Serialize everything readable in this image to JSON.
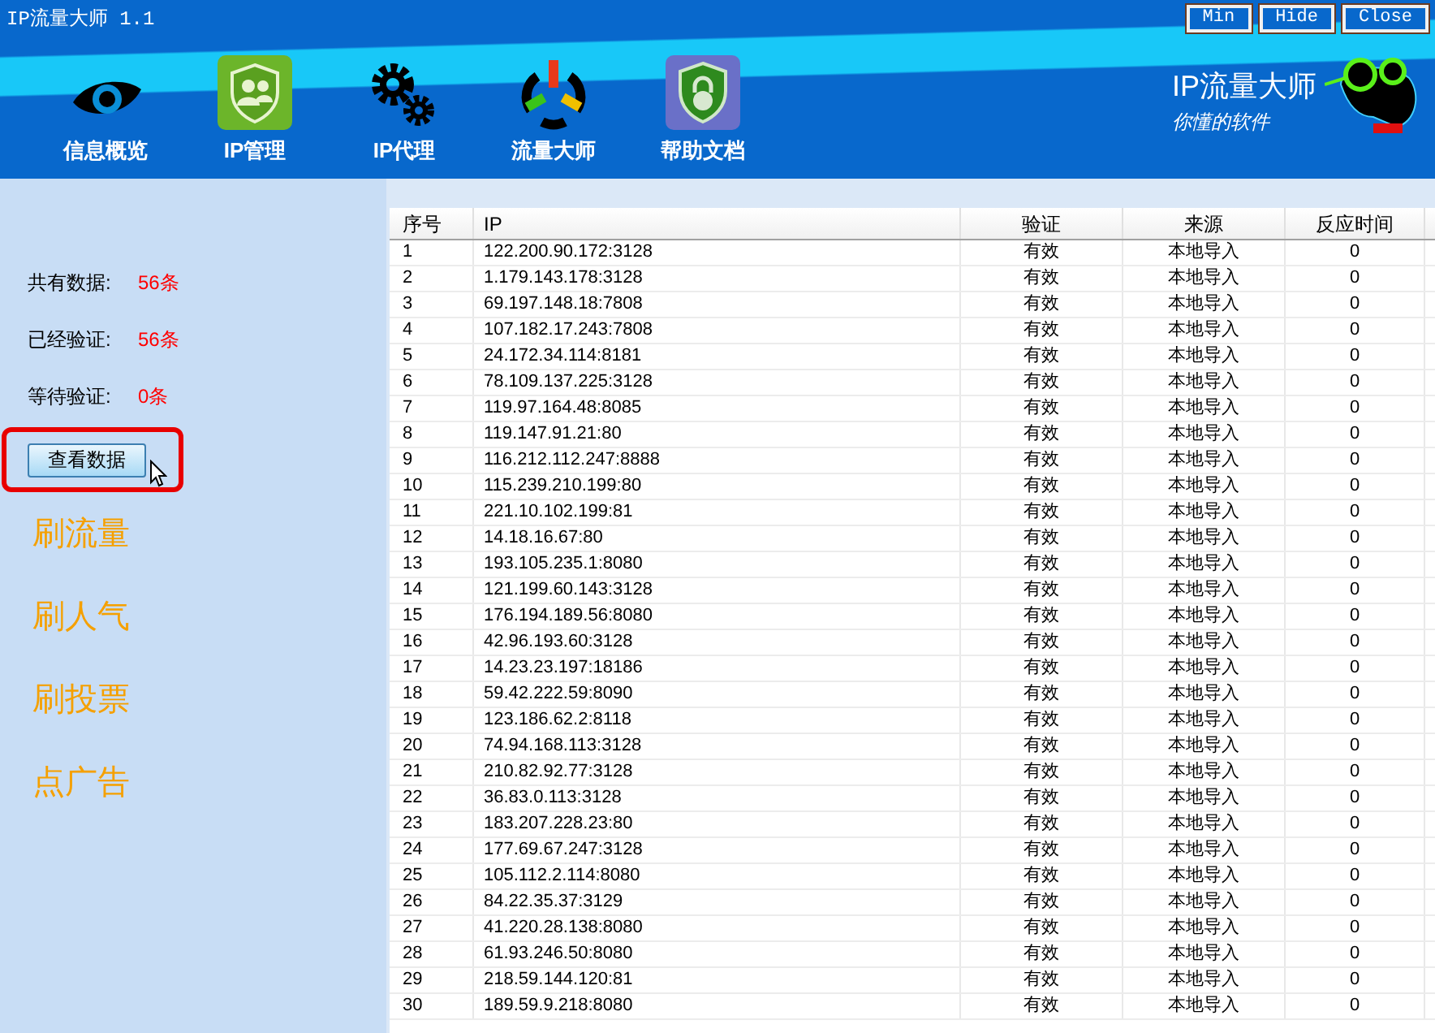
{
  "window": {
    "title": "IP流量大师 1.1",
    "buttons": [
      "Min",
      "Hide",
      "Close"
    ]
  },
  "nav": [
    {
      "label": "信息概览",
      "kind": "eye"
    },
    {
      "label": "IP管理",
      "kind": "users"
    },
    {
      "label": "IP代理",
      "kind": "gears"
    },
    {
      "label": "流量大师",
      "kind": "power"
    },
    {
      "label": "帮助文档",
      "kind": "lock"
    }
  ],
  "brand": {
    "name": "IP流量大师",
    "slogan": "你懂的软件"
  },
  "stats": [
    {
      "label": "共有数据:",
      "value": "56条"
    },
    {
      "label": "已经验证:",
      "value": "56条"
    },
    {
      "label": "等待验证:",
      "value": "0条"
    }
  ],
  "view_button": "查看数据",
  "links": [
    "刷流量",
    "刷人气",
    "刷投票",
    "点广告"
  ],
  "table": {
    "columns": [
      "序号",
      "IP",
      "验证",
      "来源",
      "反应时间"
    ],
    "rows": [
      [
        "1",
        "122.200.90.172:3128",
        "有效",
        "本地导入",
        "0"
      ],
      [
        "2",
        "1.179.143.178:3128",
        "有效",
        "本地导入",
        "0"
      ],
      [
        "3",
        "69.197.148.18:7808",
        "有效",
        "本地导入",
        "0"
      ],
      [
        "4",
        "107.182.17.243:7808",
        "有效",
        "本地导入",
        "0"
      ],
      [
        "5",
        "24.172.34.114:8181",
        "有效",
        "本地导入",
        "0"
      ],
      [
        "6",
        "78.109.137.225:3128",
        "有效",
        "本地导入",
        "0"
      ],
      [
        "7",
        "119.97.164.48:8085",
        "有效",
        "本地导入",
        "0"
      ],
      [
        "8",
        "119.147.91.21:80",
        "有效",
        "本地导入",
        "0"
      ],
      [
        "9",
        "116.212.112.247:8888",
        "有效",
        "本地导入",
        "0"
      ],
      [
        "10",
        "115.239.210.199:80",
        "有效",
        "本地导入",
        "0"
      ],
      [
        "11",
        "221.10.102.199:81",
        "有效",
        "本地导入",
        "0"
      ],
      [
        "12",
        "14.18.16.67:80",
        "有效",
        "本地导入",
        "0"
      ],
      [
        "13",
        "193.105.235.1:8080",
        "有效",
        "本地导入",
        "0"
      ],
      [
        "14",
        "121.199.60.143:3128",
        "有效",
        "本地导入",
        "0"
      ],
      [
        "15",
        "176.194.189.56:8080",
        "有效",
        "本地导入",
        "0"
      ],
      [
        "16",
        "42.96.193.60:3128",
        "有效",
        "本地导入",
        "0"
      ],
      [
        "17",
        "14.23.23.197:18186",
        "有效",
        "本地导入",
        "0"
      ],
      [
        "18",
        "59.42.222.59:8090",
        "有效",
        "本地导入",
        "0"
      ],
      [
        "19",
        "123.186.62.2:8118",
        "有效",
        "本地导入",
        "0"
      ],
      [
        "20",
        "74.94.168.113:3128",
        "有效",
        "本地导入",
        "0"
      ],
      [
        "21",
        "210.82.92.77:3128",
        "有效",
        "本地导入",
        "0"
      ],
      [
        "22",
        "36.83.0.113:3128",
        "有效",
        "本地导入",
        "0"
      ],
      [
        "23",
        "183.207.228.23:80",
        "有效",
        "本地导入",
        "0"
      ],
      [
        "24",
        "177.69.67.247:3128",
        "有效",
        "本地导入",
        "0"
      ],
      [
        "25",
        "105.112.2.114:8080",
        "有效",
        "本地导入",
        "0"
      ],
      [
        "26",
        "84.22.35.37:3129",
        "有效",
        "本地导入",
        "0"
      ],
      [
        "27",
        "41.220.28.138:8080",
        "有效",
        "本地导入",
        "0"
      ],
      [
        "28",
        "61.93.246.50:8080",
        "有效",
        "本地导入",
        "0"
      ],
      [
        "29",
        "218.59.144.120:81",
        "有效",
        "本地导入",
        "0"
      ],
      [
        "30",
        "189.59.9.218:8080",
        "有效",
        "本地导入",
        "0"
      ]
    ]
  }
}
